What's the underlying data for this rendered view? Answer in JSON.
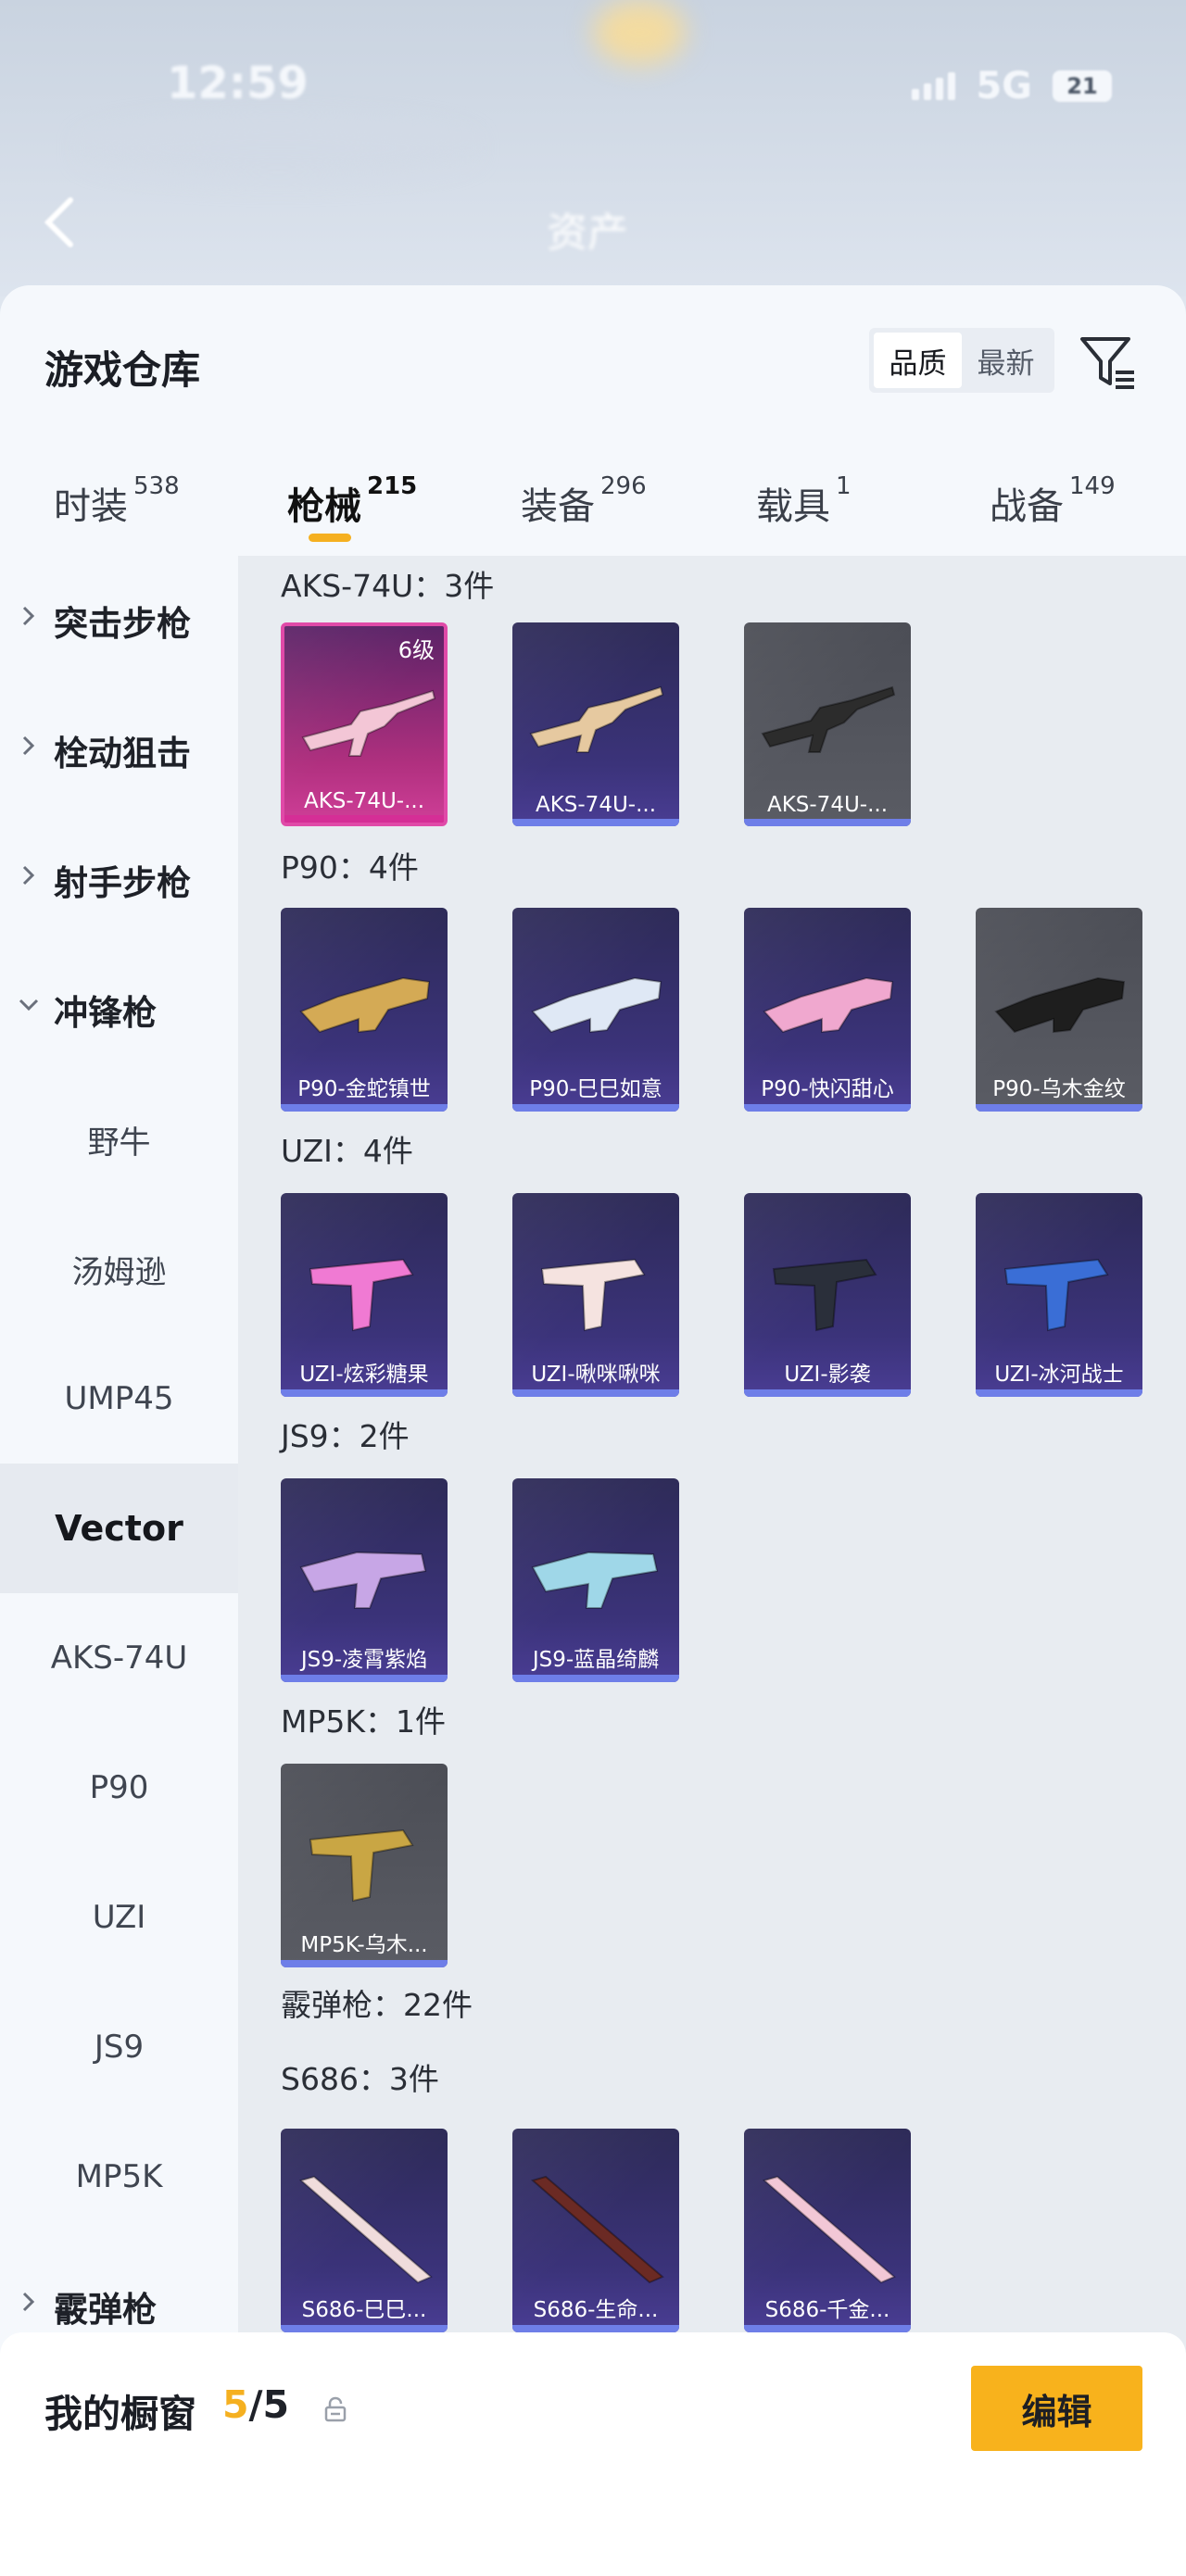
{
  "status_bar": {
    "time": "12:59",
    "network": "5G",
    "battery": "21"
  },
  "background": {
    "title": "资产"
  },
  "header": {
    "title": "游戏仓库",
    "sort_options": [
      "品质",
      "最新"
    ],
    "sort_active": "品质"
  },
  "category_tabs": [
    {
      "label": "时装",
      "count": "538",
      "active": false
    },
    {
      "label": "枪械",
      "count": "215",
      "active": true
    },
    {
      "label": "装备",
      "count": "296",
      "active": false
    },
    {
      "label": "载具",
      "count": "1",
      "active": false
    },
    {
      "label": "战备",
      "count": "149",
      "active": false
    }
  ],
  "sidebar": {
    "items": [
      {
        "label": "突击步枪",
        "type": "group",
        "expanded": false
      },
      {
        "label": "栓动狙击",
        "type": "group",
        "expanded": false
      },
      {
        "label": "射手步枪",
        "type": "group",
        "expanded": false
      },
      {
        "label": "冲锋枪",
        "type": "group",
        "expanded": true
      },
      {
        "label": "野牛",
        "type": "sub"
      },
      {
        "label": "汤姆逊",
        "type": "sub"
      },
      {
        "label": "UMP45",
        "type": "sub"
      },
      {
        "label": "Vector",
        "type": "sub",
        "selected": true
      },
      {
        "label": "AKS-74U",
        "type": "sub"
      },
      {
        "label": "P90",
        "type": "sub"
      },
      {
        "label": "UZI",
        "type": "sub"
      },
      {
        "label": "JS9",
        "type": "sub"
      },
      {
        "label": "MP5K",
        "type": "sub"
      },
      {
        "label": "霰弹枪",
        "type": "group",
        "expanded": false
      }
    ]
  },
  "sections": [
    {
      "title": "AKS-74U：3件",
      "items": [
        {
          "label": "AKS-74U-...",
          "style": "pink",
          "level": "6级",
          "icon": "rifle-pink-icon",
          "color": "#f3c6d6"
        },
        {
          "label": "AKS-74U-...",
          "style": "purple",
          "icon": "rifle-gold-icon",
          "color": "#e6c9a0"
        },
        {
          "label": "AKS-74U-...",
          "style": "gray",
          "icon": "rifle-dark-icon",
          "color": "#2c2c2c"
        }
      ]
    },
    {
      "title": "P90：4件",
      "items": [
        {
          "label": "P90-金蛇镇世",
          "style": "purple",
          "icon": "p90-gold-icon",
          "color": "#d4aa55"
        },
        {
          "label": "P90-巳巳如意",
          "style": "purple",
          "icon": "p90-white-icon",
          "color": "#dfe8f5"
        },
        {
          "label": "P90-快闪甜心",
          "style": "purple",
          "icon": "p90-pink-icon",
          "color": "#f0a8cf"
        },
        {
          "label": "P90-乌木金纹",
          "style": "gray",
          "icon": "p90-black-icon",
          "color": "#1e1e1e"
        }
      ]
    },
    {
      "title": "UZI：4件",
      "items": [
        {
          "label": "UZI-炫彩糖果",
          "style": "purple",
          "icon": "uzi-candy-icon",
          "color": "#f07ad3"
        },
        {
          "label": "UZI-啾咪啾咪",
          "style": "purple",
          "icon": "uzi-cream-icon",
          "color": "#f5e3e0"
        },
        {
          "label": "UZI-影袭",
          "style": "purple",
          "icon": "uzi-shadow-icon",
          "color": "#2a2f3a"
        },
        {
          "label": "UZI-冰河战士",
          "style": "purple",
          "icon": "uzi-ice-icon",
          "color": "#3a6ed6"
        }
      ]
    },
    {
      "title": "JS9：2件",
      "items": [
        {
          "label": "JS9-凌霄紫焰",
          "style": "purple",
          "icon": "js9-violet-icon",
          "color": "#c7a6e6"
        },
        {
          "label": "JS9-蓝晶绮麟",
          "style": "purple",
          "icon": "js9-crystal-icon",
          "color": "#9fd7e8"
        }
      ]
    },
    {
      "title": "MP5K：1件",
      "items": [
        {
          "label": "MP5K-乌木...",
          "style": "gray",
          "icon": "mp5k-ebony-icon",
          "color": "#c9a644"
        }
      ]
    },
    {
      "title": "霰弹枪：22件",
      "items": []
    },
    {
      "title": "S686：3件",
      "items": [
        {
          "label": "S686-巳巳...",
          "style": "purple",
          "icon": "shotgun-white-icon",
          "color": "#f0dcdc"
        },
        {
          "label": "S686-生命...",
          "style": "purple",
          "icon": "shotgun-wood-icon",
          "color": "#6b2a24"
        },
        {
          "label": "S686-千金...",
          "style": "purple",
          "icon": "shotgun-pink-icon",
          "color": "#f2c7d6"
        }
      ]
    }
  ],
  "bottom_bar": {
    "label": "我的橱窗",
    "used": "5",
    "total": "/5",
    "edit_label": "编辑"
  },
  "colors": {
    "accent": "#f8b21c",
    "card_purple": "#3b337a",
    "card_gray": "#55575f",
    "card_pink": "#b0307f"
  }
}
